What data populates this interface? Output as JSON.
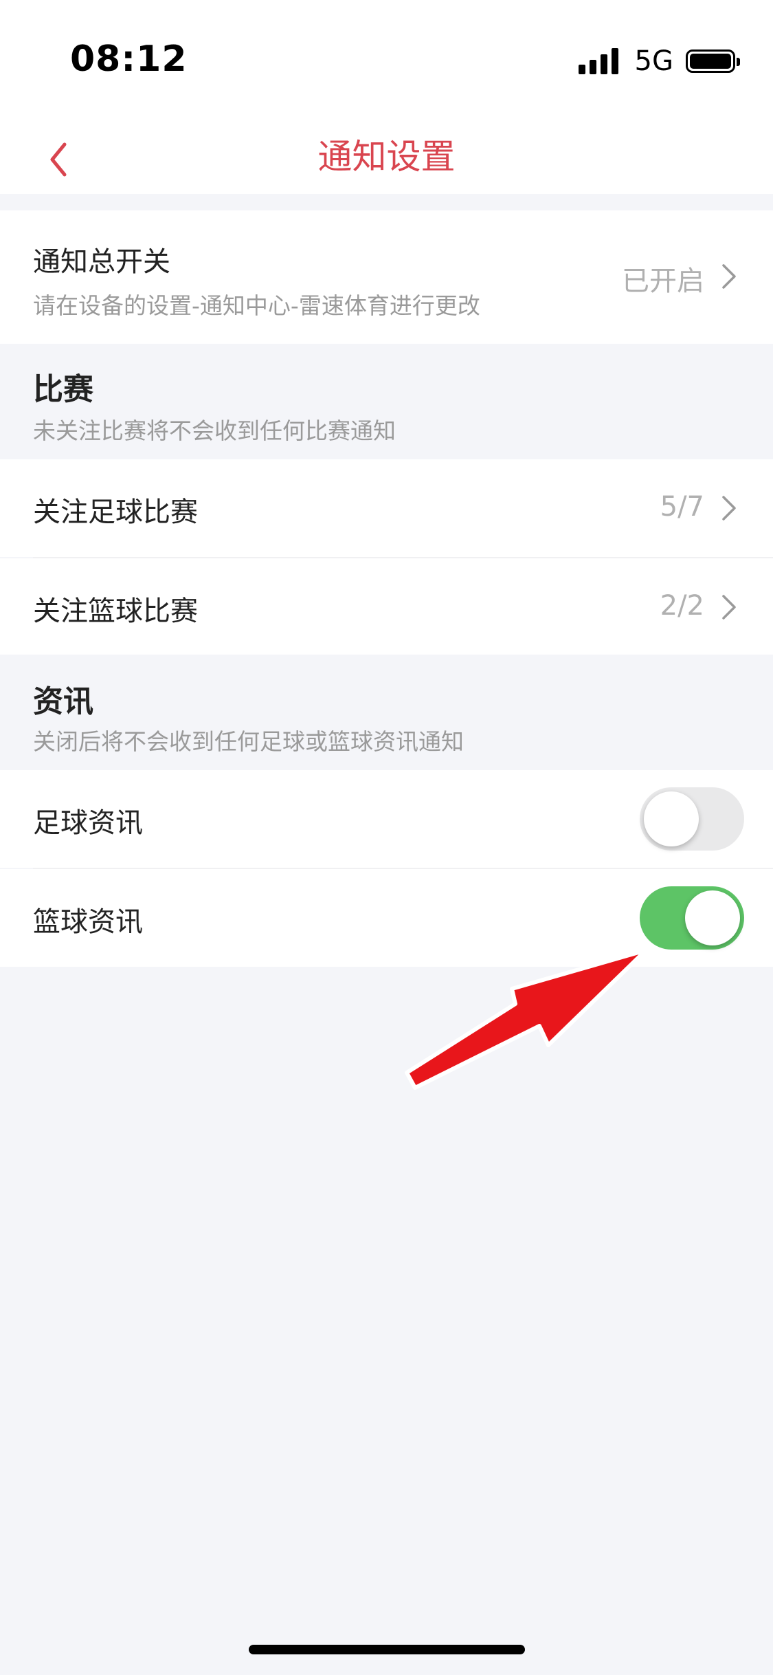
{
  "status_bar": {
    "time": "08:12",
    "network": "5G"
  },
  "nav": {
    "title": "通知设置",
    "back_icon": "chevron-left-icon"
  },
  "master_switch": {
    "label": "通知总开关",
    "subtitle": "请在设备的设置-通知中心-雷速体育进行更改",
    "value": "已开启"
  },
  "matches": {
    "title": "比赛",
    "description": "未关注比赛将不会收到任何比赛通知",
    "items": [
      {
        "label": "关注足球比赛",
        "value": "5/7"
      },
      {
        "label": "关注篮球比赛",
        "value": "2/2"
      }
    ]
  },
  "news": {
    "title": "资讯",
    "description": "关闭后将不会收到任何足球或篮球资讯通知",
    "items": [
      {
        "label": "足球资讯",
        "enabled": false
      },
      {
        "label": "篮球资讯",
        "enabled": true
      }
    ]
  },
  "colors": {
    "accent": "#d9454f",
    "toggle_on": "#5dc466",
    "toggle_off": "#e9e9ea",
    "annotation_arrow": "#e8161b"
  }
}
